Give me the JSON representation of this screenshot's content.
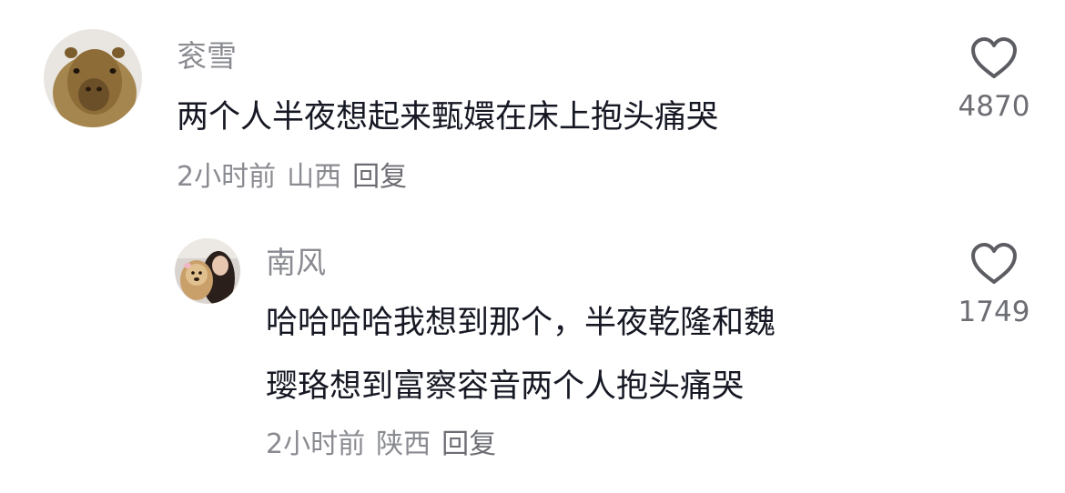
{
  "comments": [
    {
      "username": "衮雪",
      "avatar_icon": "capybara-avatar",
      "content_lines": [
        "两个人半夜想起来甄嬛在床上抱头痛哭"
      ],
      "time": "2小时前",
      "location": "山西",
      "reply_label": "回复",
      "likes": "4870"
    },
    {
      "username": "南风",
      "avatar_icon": "dog-and-girl-avatar",
      "content_lines": [
        "哈哈哈哈我想到那个，半夜乾隆和魏",
        "璎珞想到富察容音两个人抱头痛哭"
      ],
      "time": "2小时前",
      "location": "陕西",
      "reply_label": "回复",
      "likes": "1749"
    }
  ],
  "colors": {
    "username": "#8a8b91",
    "content": "#161823",
    "meta": "#8a8b91",
    "heart_stroke": "#5c5d63"
  }
}
